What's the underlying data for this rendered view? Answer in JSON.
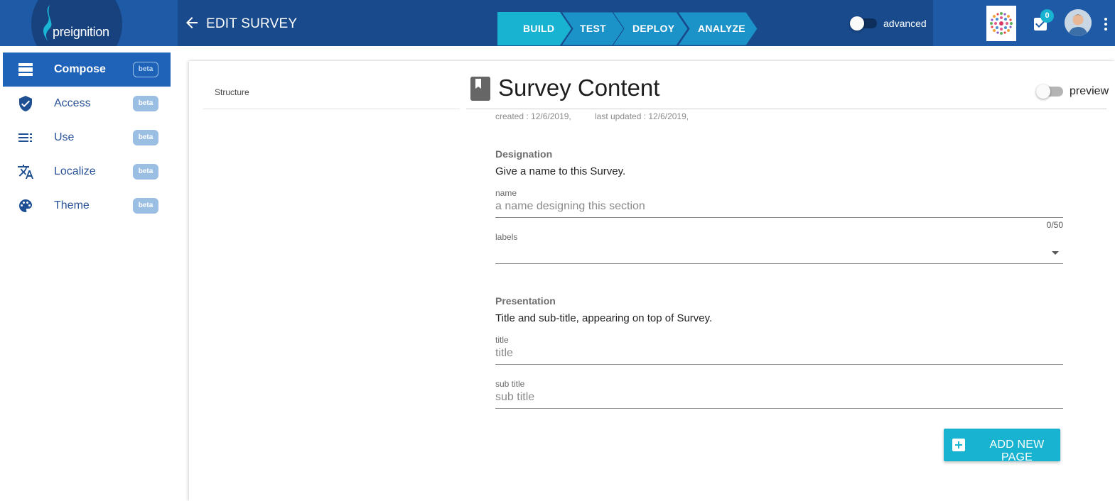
{
  "brand": {
    "name": "preignition"
  },
  "header": {
    "title": "EDIT SURVEY",
    "steps": [
      "BUILD",
      "TEST",
      "DEPLOY",
      "ANALYZE"
    ],
    "active_step": "BUILD",
    "advanced_label": "advanced",
    "advanced_enabled": false,
    "tasks_count": "0"
  },
  "sidebar": {
    "items": [
      {
        "label": "Compose",
        "badge": "beta",
        "icon": "view-agenda-icon",
        "active": true
      },
      {
        "label": "Access",
        "badge": "beta",
        "icon": "shield-check-icon",
        "active": false
      },
      {
        "label": "Use",
        "badge": "beta",
        "icon": "list-icon",
        "active": false
      },
      {
        "label": "Localize",
        "badge": "beta",
        "icon": "translate-icon",
        "active": false
      },
      {
        "label": "Theme",
        "badge": "beta",
        "icon": "palette-icon",
        "active": false
      }
    ]
  },
  "structure": {
    "title": "Structure"
  },
  "content": {
    "title": "Survey Content",
    "preview_label": "preview",
    "preview_enabled": false,
    "created": "created : 12/6/2019,",
    "updated": "last updated : 12/6/2019,"
  },
  "designation": {
    "title": "Designation",
    "description": "Give a name to this Survey.",
    "name_label": "name",
    "name_placeholder": "a name designing this section",
    "name_counter": "0/50",
    "labels_label": "labels"
  },
  "presentation": {
    "title": "Presentation",
    "description": "Title and sub-title, appearing on top of Survey.",
    "title_label": "title",
    "title_placeholder": "title",
    "subtitle_label": "sub title",
    "subtitle_placeholder": "sub title"
  },
  "actions": {
    "add_page_label": "ADD NEW PAGE"
  },
  "colors": {
    "topbar": "#184a8c",
    "topbar_accent": "#1f5aa6",
    "active_step": "#17b3d0",
    "step": "#1c93c8",
    "sidebar_active": "#1f63b8",
    "badge": "#9bbfe3",
    "button": "#17b3d0"
  }
}
